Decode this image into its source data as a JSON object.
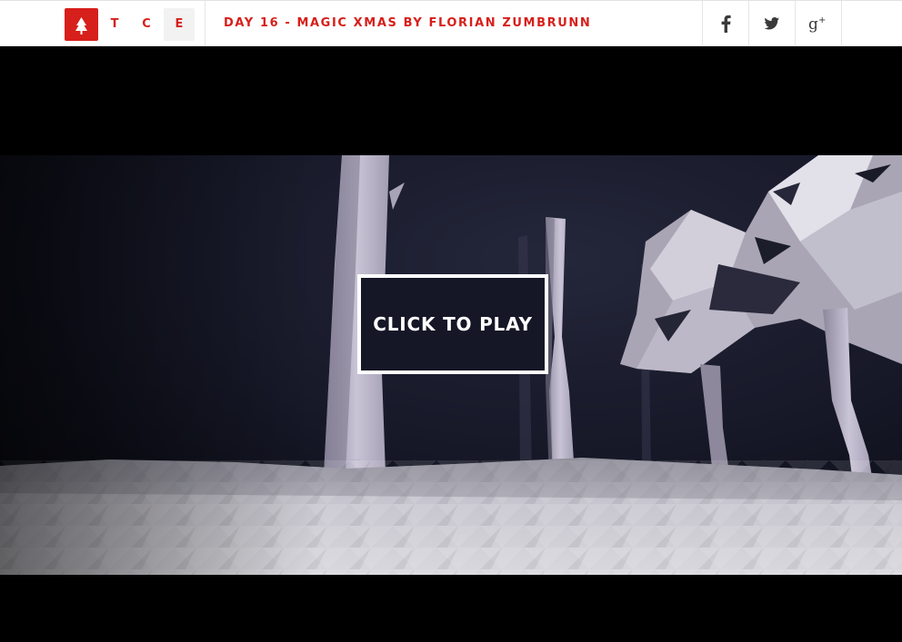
{
  "header": {
    "logo_icon": "christmas-tree-icon",
    "nav": {
      "t": "T",
      "c": "C",
      "e": "E"
    },
    "title": "DAY 16 - MAGIC XMAS BY FLORIAN ZUMBRUNN",
    "share": [
      {
        "name": "facebook",
        "icon": "facebook-icon"
      },
      {
        "name": "twitter",
        "icon": "twitter-icon"
      },
      {
        "name": "google-plus",
        "icon": "google-plus-icon"
      }
    ]
  },
  "game": {
    "play_label": "CLICK TO PLAY"
  },
  "colors": {
    "accent": "#d71f1b",
    "background": "#000000",
    "sky": "#161827",
    "snow": "#c9c7d0"
  }
}
